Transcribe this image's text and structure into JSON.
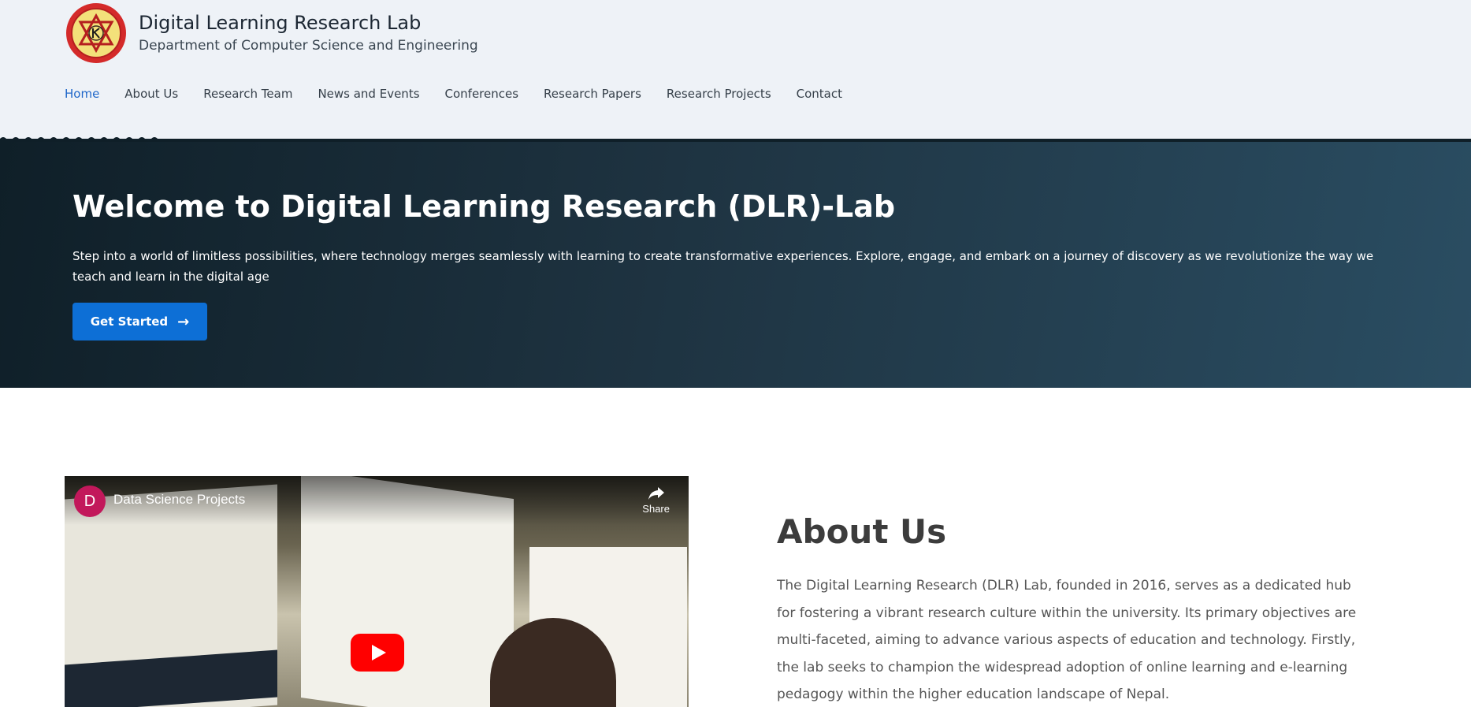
{
  "header": {
    "title": "Digital Learning Research Lab",
    "subtitle": "Department of Computer Science and Engineering"
  },
  "nav": {
    "items": [
      "Home",
      "About Us",
      "Research Team",
      "News and Events",
      "Conferences",
      "Research Papers",
      "Research Projects",
      "Contact"
    ],
    "active": "Home"
  },
  "hero": {
    "title": "Welcome to Digital Learning Research (DLR)-Lab",
    "text": "Step into a world of limitless possibilities, where technology merges seamlessly with learning to create transformative experiences. Explore, engage, and embark on a journey of discovery as we revolutionize the way we teach and learn in the digital age",
    "button_label": "Get Started"
  },
  "video": {
    "channel_initial": "D",
    "title": "Data Science Projects",
    "share_label": "Share"
  },
  "about": {
    "title": "About Us",
    "text": "The Digital Learning Research (DLR) Lab, founded in 2016, serves as a dedicated hub for fostering a vibrant research culture within the university. Its primary objectives are multi-faceted, aiming to advance various aspects of education and technology. Firstly, the lab seeks to champion the widespread adoption of online learning and e-learning pedagogy within the higher education landscape of Nepal."
  },
  "colors": {
    "accent": "#0d6fd6",
    "nav_active": "#1f67c9",
    "hero_bg": "#1e3341"
  }
}
